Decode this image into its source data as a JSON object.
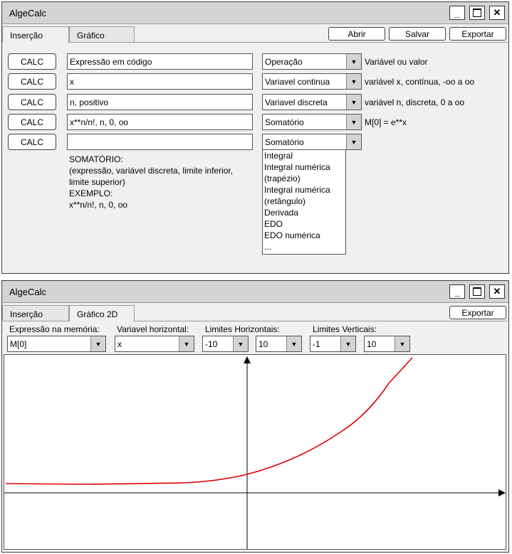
{
  "window1": {
    "title": "AlgeCalc",
    "tabs": [
      "Inserção",
      "Gráfico"
    ],
    "buttons": {
      "open": "Abrir",
      "save": "Salvar",
      "export": "Exportar"
    },
    "rows": [
      {
        "calc": "CALC",
        "expr": "Expressão em código",
        "op": "Operação",
        "desc": "Variável ou valor"
      },
      {
        "calc": "CALC",
        "expr": "x",
        "op": "Variavel continua",
        "desc": "variável x, contínua, -oo a oo"
      },
      {
        "calc": "CALC",
        "expr": "n, positivo",
        "op": "Variavel discreta",
        "desc": "variável n, discreta, 0 a oo"
      },
      {
        "calc": "CALC",
        "expr": "x**n/n!, n, 0, oo",
        "op": "Somatório",
        "desc": "M[0] = e**x"
      },
      {
        "calc": "CALC",
        "expr": "",
        "op": "Somatório",
        "desc": ""
      }
    ],
    "help": {
      "title": "SOMATÓRIO:",
      "line1": "(expressão, variável discreta, limite inferior,",
      "line2": "limite superior)",
      "example_label": "EXEMPLO:",
      "example": "x**n/n!, n, 0, oo"
    },
    "dropdown_options": [
      "Integral",
      "Integral numérica",
      "(trapézio)",
      "Integral numérica",
      "(retângulo)",
      "Derivada",
      "EDO",
      "EDO numérica",
      "..."
    ]
  },
  "window2": {
    "title": "AlgeCalc",
    "tabs": [
      "Inserção",
      "Gráfico 2D"
    ],
    "export": "Exportar",
    "labels": {
      "memory": "Expressão na memória:",
      "horizontal": "Variavel horizontal:",
      "hlimits": "Limites Horizontais:",
      "vlimits": "Limites Verticais:"
    },
    "values": {
      "memory": "M[0]",
      "horizontal": "x",
      "hmin": "-10",
      "hmax": "10",
      "vmin": "-1",
      "vmax": "10"
    }
  },
  "colors": {
    "curve": "#e00000"
  }
}
